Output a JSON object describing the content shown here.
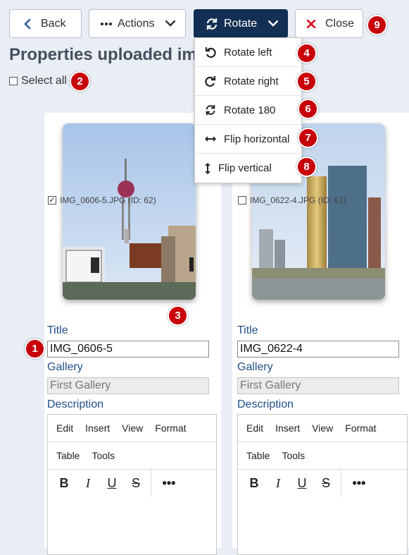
{
  "toolbar": {
    "back_label": "Back",
    "actions_label": "Actions",
    "rotate_label": "Rotate",
    "close_label": "Close"
  },
  "rotate_menu": [
    {
      "label": "Rotate left",
      "icon": "rotate-left-icon"
    },
    {
      "label": "Rotate right",
      "icon": "rotate-right-icon"
    },
    {
      "label": "Rotate 180",
      "icon": "rotate-180-icon"
    },
    {
      "label": "Flip horizontal",
      "icon": "flip-horizontal-icon"
    },
    {
      "label": "Flip vertical",
      "icon": "flip-vertical-icon"
    }
  ],
  "page": {
    "title": "Properties uploaded images",
    "select_all": "Select all"
  },
  "images": [
    {
      "filename": "IMG_0606-5.JPG (ID: 62)",
      "checked": true,
      "title_value": "IMG_0606-5",
      "gallery_value": "First Gallery"
    },
    {
      "filename": "IMG_0622-4.JPG (ID: 61)",
      "checked": false,
      "title_value": "IMG_0622-4",
      "gallery_value": "First Gallery"
    }
  ],
  "labels": {
    "title": "Title",
    "gallery": "Gallery",
    "description": "Description"
  },
  "editor": {
    "menu": [
      "Edit",
      "Insert",
      "View",
      "Format"
    ],
    "menu2": [
      "Table",
      "Tools"
    ]
  },
  "badges": [
    "1",
    "2",
    "3",
    "4",
    "5",
    "6",
    "7",
    "8",
    "9"
  ],
  "colors": {
    "accent": "#132f53",
    "badge": "#c8000a",
    "close_icon": "#d6001c",
    "label": "#1f4f88"
  }
}
